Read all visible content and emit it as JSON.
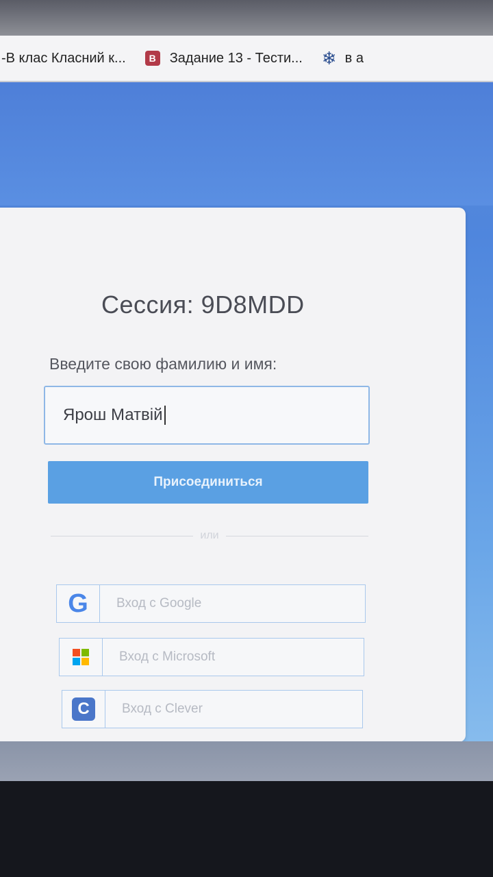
{
  "bookmarks": [
    {
      "label": "-В клас Класний к...",
      "icon": "none"
    },
    {
      "label": "Задание 13 - Тести...",
      "icon": "b-badge-icon",
      "icon_glyph": "B"
    },
    {
      "label": "в а",
      "icon": "snowflake-icon",
      "icon_glyph": "❄"
    }
  ],
  "session": {
    "title": "Сессия: 9D8MDD"
  },
  "form": {
    "label": "Введите свою фамилию и имя:",
    "name_value": "Ярош Матвій",
    "join_label": "Присоединиться",
    "divider_text": "или"
  },
  "sso": {
    "google_label": "Вход с Google",
    "google_glyph": "G",
    "microsoft_label": "Вход с Microsoft",
    "clever_label": "Вход с Clever",
    "clever_glyph": "C"
  },
  "colors": {
    "accent": "#5aa0e3",
    "microsoft": [
      "#f25022",
      "#7fba00",
      "#00a4ef",
      "#ffb900"
    ]
  }
}
